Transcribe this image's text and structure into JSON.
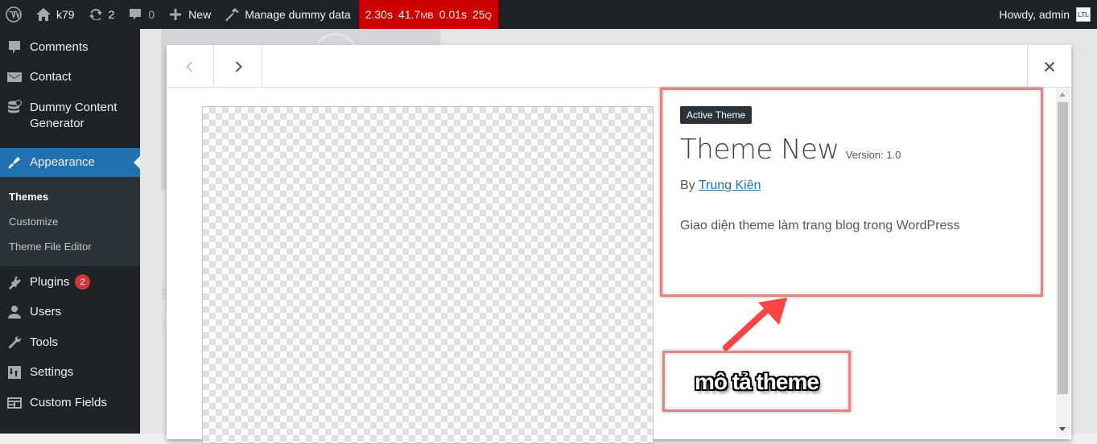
{
  "adminbar": {
    "site_name": "k79",
    "updates_count": "2",
    "comments_count": "0",
    "new_label": "New",
    "manage_dummy_label": "Manage dummy data",
    "query_monitor": {
      "time": "2.30s",
      "memory": "41.7",
      "memory_unit": "MB",
      "db_time": "0.01s",
      "queries": "25",
      "queries_unit": "Q"
    },
    "howdy": "Howdy, admin",
    "avatar_text": "LTL"
  },
  "sidebar": {
    "items": [
      {
        "label": "Comments",
        "icon": "comment-icon"
      },
      {
        "label": "Contact",
        "icon": "mail-icon"
      },
      {
        "label": "Dummy Content Generator",
        "label_line1": "Dummy Content",
        "label_line2": "Generator",
        "icon": "database-icon"
      },
      {
        "label": "Appearance",
        "icon": "paintbrush-icon",
        "current": true
      },
      {
        "label": "Plugins",
        "icon": "plugin-icon",
        "badge": "2"
      },
      {
        "label": "Users",
        "icon": "users-icon"
      },
      {
        "label": "Tools",
        "icon": "wrench-icon"
      },
      {
        "label": "Settings",
        "icon": "settings-icon"
      },
      {
        "label": "Custom Fields",
        "icon": "custom-fields-icon"
      }
    ],
    "submenu": [
      {
        "label": "Themes",
        "active": true
      },
      {
        "label": "Customize"
      },
      {
        "label": "Theme File Editor"
      }
    ]
  },
  "background": {
    "text_b": "B",
    "text_t": "T"
  },
  "modal": {
    "active_badge": "Active Theme",
    "theme_name": "Theme New",
    "version": "Version: 1.0",
    "by_label": "By",
    "author": "Trung Kiên",
    "description": "Giao diện theme làm trang blog trong WordPress"
  },
  "annotation": {
    "label": "mô tả theme",
    "color": "#f08080",
    "arrow_color": "#ff4444"
  }
}
